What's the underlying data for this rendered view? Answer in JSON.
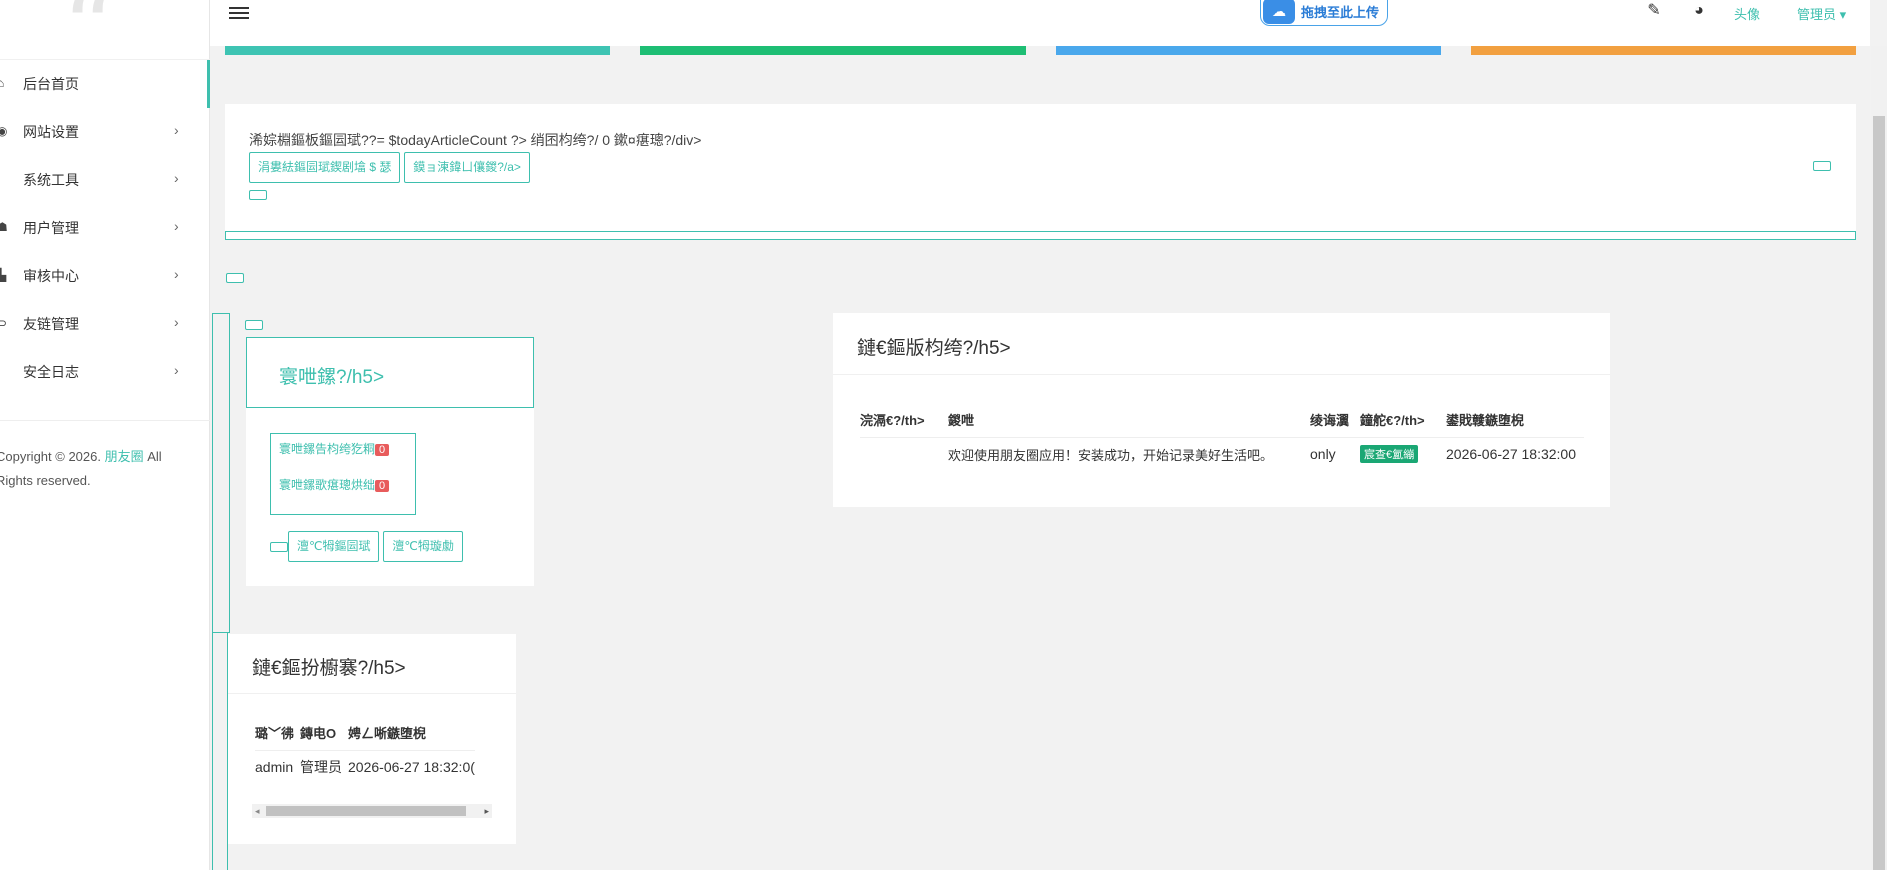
{
  "sidebar": {
    "logo_glyph": "“",
    "items": [
      {
        "label": "后台首页",
        "icon": "home-icon",
        "glyph": "⌂",
        "has_arrow": false
      },
      {
        "label": "网站设置",
        "icon": "globe-icon",
        "glyph": "◉",
        "has_arrow": true
      },
      {
        "label": "系统工具",
        "icon": "tools-icon",
        "glyph": "",
        "has_arrow": true
      },
      {
        "label": "用户管理",
        "icon": "users-icon",
        "glyph": "☗",
        "has_arrow": true
      },
      {
        "label": "审核中心",
        "icon": "audit-icon",
        "glyph": "▙",
        "has_arrow": true
      },
      {
        "label": "友链管理",
        "icon": "link-icon",
        "glyph": "⊃",
        "has_arrow": true
      },
      {
        "label": "安全日志",
        "icon": "shield-icon",
        "glyph": "",
        "has_arrow": true
      }
    ],
    "footer": {
      "line1_prefix": "Copyright © 2026.",
      "line1_link": "朋友圈",
      "line1_suffix": "All",
      "line2": "Rights reserved."
    }
  },
  "header": {
    "upload_label": "拖拽至此上传",
    "avatar_alt": "头像",
    "admin_label": "管理员",
    "admin_caret": "▾"
  },
  "stat_colors": [
    "#3ec4b3",
    "#1ebe74",
    "#4aa8ec",
    "#f2a040"
  ],
  "accent": "#3ebfae",
  "welcome": {
    "text": "浠婃棩鏂板鏂囩珷??= $todayArticleCount ?> 绡囨枃绔?/ 0 鏉¤瘎璁?/div>",
    "btn1": "涓婁紶鏂囩珷鍥剧墖 $ 瑟",
    "btn2": "鏌ョ湅鍏ㄩ儴鍐?/a>"
  },
  "audit": {
    "title": "寰呭鏍?/h5>",
    "row1": "寰呭鏍告枃绔犵粡",
    "row1_count": "0",
    "row2": "寰呭鏍歌瘎璁烘绌",
    "row2_count": "0",
    "btn1": "澶℃牳鏂囩珷",
    "btn2": "澶℃牳璇勮"
  },
  "latest": {
    "title": "鏈€鏂版枃绔?/h5>",
    "headers": [
      "浣滆€?/th>",
      "鍐呭",
      "绫诲瀷",
      "鐘舵€?/th>",
      "鍙戝竷鏃堕棿"
    ],
    "rows": [
      {
        "author": "",
        "content": "欢迎使用朋友圈应用！安装成功，开始记录美好生活吧。",
        "type": "only",
        "status": "宸查€氳繃",
        "time": "2026-06-27 18:32:00"
      }
    ]
  },
  "login_log": {
    "title": "鏈€鏂扮櫥褰?/h5>",
    "headers": [
      "璐﹀彿",
      "鏄电О",
      "娉ㄥ唽鏃堕棿"
    ],
    "rows": [
      {
        "account": "admin",
        "nick": "管理员",
        "time": "2026-06-27 18:32:0("
      }
    ]
  }
}
